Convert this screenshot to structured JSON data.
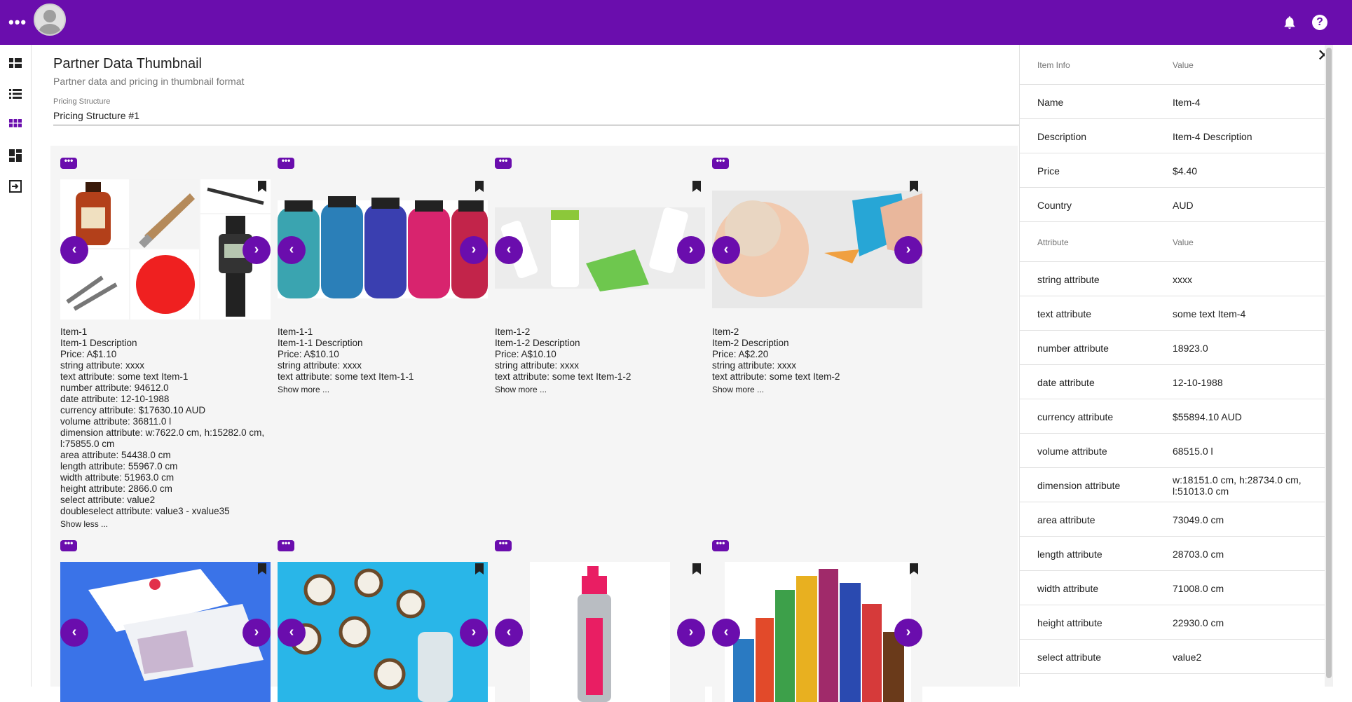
{
  "header": {
    "title": "Partner Data Thumbnail",
    "subtitle": "Partner data and pricing in thumbnail format",
    "pricing_label": "Pricing Structure",
    "pricing_value": "Pricing Structure #1"
  },
  "colors": {
    "brand": "#6a0dad",
    "background": "#f5f5f5"
  },
  "topbar": {
    "menu_icon": "more-horiz-icon",
    "notifications_icon": "bell-icon",
    "help_icon": "help-icon",
    "help_glyph": "?"
  },
  "rail": {
    "icons": [
      "dashboard-icon",
      "list-icon",
      "grid-icon",
      "widgets-icon",
      "exit-icon"
    ]
  },
  "cards": [
    {
      "name": "Item-1",
      "description": "Item-1 Description",
      "price": "Price: A$1.10",
      "lines": [
        "string attribute: xxxx",
        "text attribute: some text Item-1",
        "number attribute: 94612.0",
        "date attribute: 12-10-1988",
        "currency attribute: $17630.10 AUD",
        "volume attribute: 36811.0 l",
        "dimension attribute: w:7622.0 cm, h:15282.0 cm, l:75855.0 cm",
        "area attribute: 54438.0 cm",
        "length attribute: 55967.0 cm",
        "width attribute: 51963.0 cm",
        "height attribute: 2866.0 cm",
        "select attribute: value2",
        "doubleselect attribute: value3 - xvalue35"
      ],
      "toggle": "Show less ..."
    },
    {
      "name": "Item-1-1",
      "description": "Item-1-1 Description",
      "price": "Price: A$10.10",
      "lines": [
        "string attribute: xxxx",
        "text attribute: some text Item-1-1"
      ],
      "toggle": "Show more ..."
    },
    {
      "name": "Item-1-2",
      "description": "Item-1-2 Description",
      "price": "Price: A$10.10",
      "lines": [
        "string attribute: xxxx",
        "text attribute: some text Item-1-2"
      ],
      "toggle": "Show more ..."
    },
    {
      "name": "Item-2",
      "description": "Item-2 Description",
      "price": "Price: A$2.20",
      "lines": [
        "string attribute: xxxx",
        "text attribute: some text Item-2"
      ],
      "toggle": "Show more ..."
    }
  ],
  "card_buttons": {
    "menu": "•••",
    "prev": "‹",
    "next": "›"
  },
  "panel": {
    "info_header": {
      "key": "Item Info",
      "value": "Value"
    },
    "info_rows": [
      {
        "key": "Name",
        "value": "Item-4"
      },
      {
        "key": "Description",
        "value": "Item-4 Description"
      },
      {
        "key": "Price",
        "value": "$4.40"
      },
      {
        "key": "Country",
        "value": "AUD"
      }
    ],
    "attr_header": {
      "key": "Attribute",
      "value": "Value"
    },
    "attr_rows": [
      {
        "key": "string attribute",
        "value": "xxxx"
      },
      {
        "key": "text attribute",
        "value": "some text Item-4"
      },
      {
        "key": "number attribute",
        "value": "18923.0"
      },
      {
        "key": "date attribute",
        "value": "12-10-1988"
      },
      {
        "key": "currency attribute",
        "value": "$55894.10 AUD"
      },
      {
        "key": "volume attribute",
        "value": "68515.0 l"
      },
      {
        "key": "dimension attribute",
        "value": "w:18151.0 cm, h:28734.0 cm, l:51013.0 cm"
      },
      {
        "key": "area attribute",
        "value": "73049.0 cm"
      },
      {
        "key": "length attribute",
        "value": "28703.0 cm"
      },
      {
        "key": "width attribute",
        "value": "71008.0 cm"
      },
      {
        "key": "height attribute",
        "value": "22930.0 cm"
      },
      {
        "key": "select attribute",
        "value": "value2"
      }
    ],
    "close_glyph": "✕"
  }
}
